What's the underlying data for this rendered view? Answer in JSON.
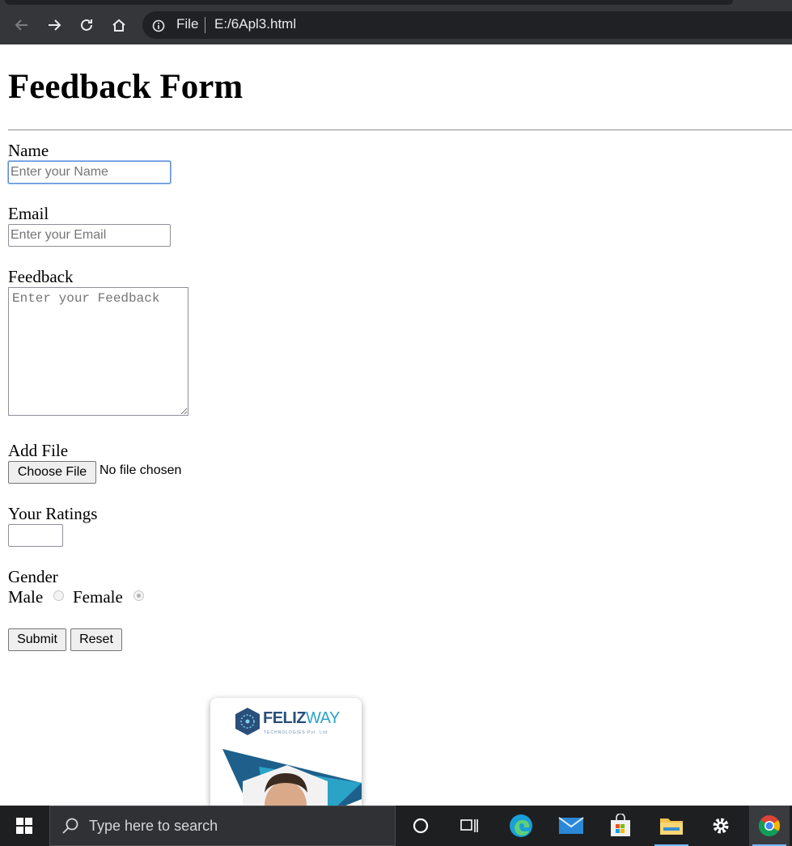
{
  "browser": {
    "scheme_label": "File",
    "url": "E:/6Apl3.html"
  },
  "page": {
    "title": "Feedback Form",
    "fields": {
      "name_label": "Name",
      "name_placeholder": "Enter your Name",
      "email_label": "Email",
      "email_placeholder": "Enter your Email",
      "feedback_label": "Feedback",
      "feedback_placeholder": "Enter your Feedback",
      "file_label": "Add File",
      "file_button": "Choose File",
      "file_status": "No file chosen",
      "ratings_label": "Your Ratings",
      "ratings_value": "",
      "gender_label": "Gender",
      "gender_options": [
        "Male",
        "Female"
      ],
      "gender_selected": "Female"
    },
    "buttons": {
      "submit": "Submit",
      "reset": "Reset"
    }
  },
  "card": {
    "brand_part1": "FELIZ",
    "brand_part2": "WAY",
    "brand_sub": "TECHNOLOGIES Pvt. Ltd"
  },
  "taskbar": {
    "search_placeholder": "Type here to search"
  },
  "colors": {
    "brand_dark": "#2a4f7a",
    "brand_light": "#2aa3c7",
    "focus_outline": "#5e8fd9"
  }
}
